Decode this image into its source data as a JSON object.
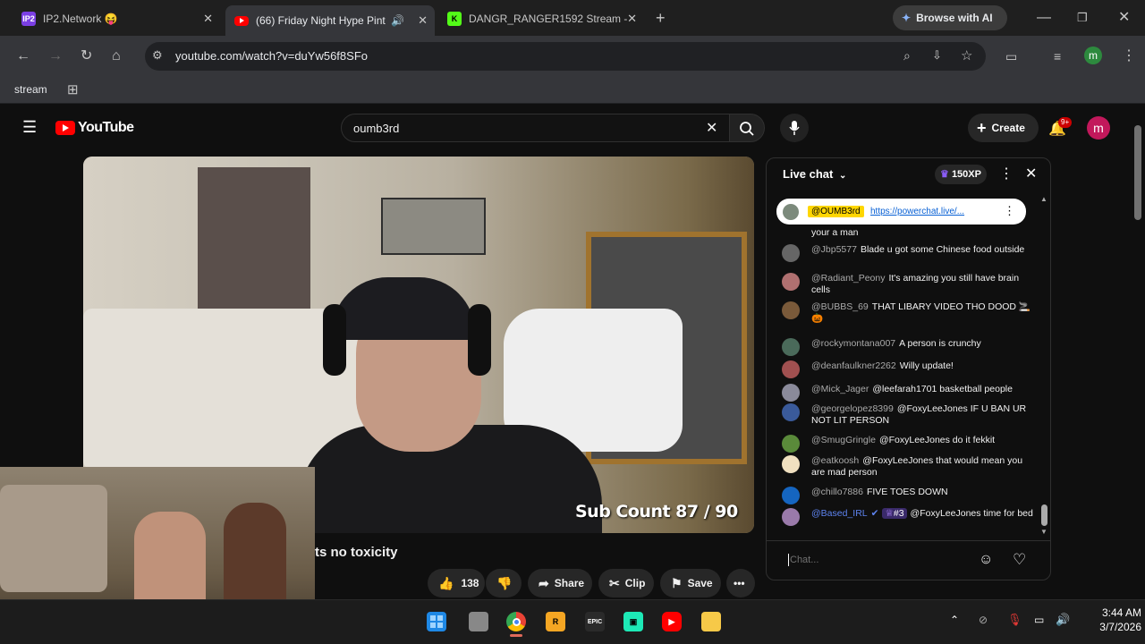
{
  "browser": {
    "tabs": [
      {
        "label": "IP2.Network 😝",
        "icon": "ip2-favicon"
      },
      {
        "label": "(66) Friday Night Hype Pint",
        "icon": "youtube-favicon"
      },
      {
        "label": "DANGR_RANGER1592 Stream -",
        "icon": "kick-favicon"
      }
    ],
    "browse_ai": "Browse with AI",
    "url": "youtube.com/watch?v=duYw56f8SFo",
    "bookmark": "stream",
    "profile_initial": "m"
  },
  "youtube": {
    "logo_text": "YouTube",
    "search_value": "oumb3rd",
    "create_label": "Create",
    "notif_count": "9+",
    "avatar_initial": "m",
    "title_fragment": "ts no toxicity",
    "overlay": "Sub Count  87 / 90",
    "actions": {
      "likes": "138",
      "share": "Share",
      "clip": "Clip",
      "save": "Save"
    }
  },
  "chat": {
    "title": "Live chat",
    "xp": "150XP",
    "pinned": {
      "user": "@OUMB3rd",
      "link": "https://powerchat.live/..."
    },
    "placeholder": "Chat...",
    "messages": [
      {
        "user": "",
        "text": "your a man"
      },
      {
        "user": "@Jbp5577",
        "text": "Blade u got some Chinese food outside"
      },
      {
        "user": "@Radiant_Peony",
        "text": "It's amazing you still have brain cells"
      },
      {
        "user": "@BUBBS_69",
        "text": "THAT LIBARY VIDEO THO DOOD 🚬 🎃"
      },
      {
        "user": "@rockymontana007",
        "text": "A person is crunchy"
      },
      {
        "user": "@deanfaulkner2262",
        "text": "Willy update!"
      },
      {
        "user": "@Mick_Jager",
        "text": "@leefarah1701 basketball people"
      },
      {
        "user": "@georgelopez8399",
        "text": "@FoxyLeeJones IF U BAN UR NOT LIT PERSON"
      },
      {
        "user": "@SmugGringle",
        "text": "@FoxyLeeJones do it fekkit"
      },
      {
        "user": "@eatkoosh",
        "text": "@FoxyLeeJones that would mean you are mad person"
      },
      {
        "user": "@chillo7886",
        "text": "FIVE TOES DOWN"
      },
      {
        "user": "@Based_IRL",
        "badge": "#3",
        "text": "@FoxyLeeJones time for bed"
      }
    ]
  },
  "taskbar": {
    "time": "3:44 AM",
    "date": "3/7/2026"
  },
  "colors": {
    "youtube_red": "#ff0000",
    "accent_yellow": "#ffd600",
    "xp_purple": "#6b2fd6"
  }
}
